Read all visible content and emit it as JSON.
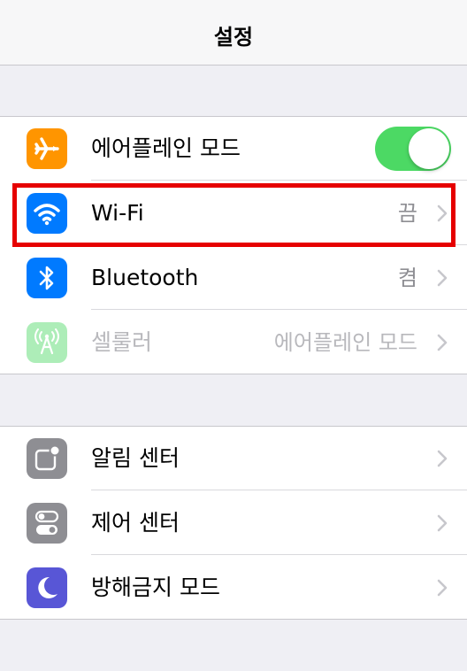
{
  "navbar": {
    "title": "설정"
  },
  "group1": {
    "airplane": {
      "label": "에어플레인 모드",
      "toggle_on": true,
      "icon": "airplane-icon",
      "color": "#ff9500"
    },
    "wifi": {
      "label": "Wi-Fi",
      "value": "끔",
      "icon": "wifi-icon",
      "color": "#007aff"
    },
    "bluetooth": {
      "label": "Bluetooth",
      "value": "켬",
      "icon": "bluetooth-icon",
      "color": "#007aff"
    },
    "cellular": {
      "label": "셀룰러",
      "value": "에어플레인 모드",
      "icon": "cellular-antenna-icon",
      "color": "#4cd964",
      "disabled": true
    }
  },
  "group2": {
    "notifications": {
      "label": "알림 센터",
      "icon": "notification-center-icon",
      "color": "#8e8e93"
    },
    "control_center": {
      "label": "제어 센터",
      "icon": "control-center-icon",
      "color": "#8e8e93"
    },
    "do_not_disturb": {
      "label": "방해금지 모드",
      "icon": "moon-icon",
      "color": "#5856d6"
    }
  },
  "highlight_color": "#e60000"
}
